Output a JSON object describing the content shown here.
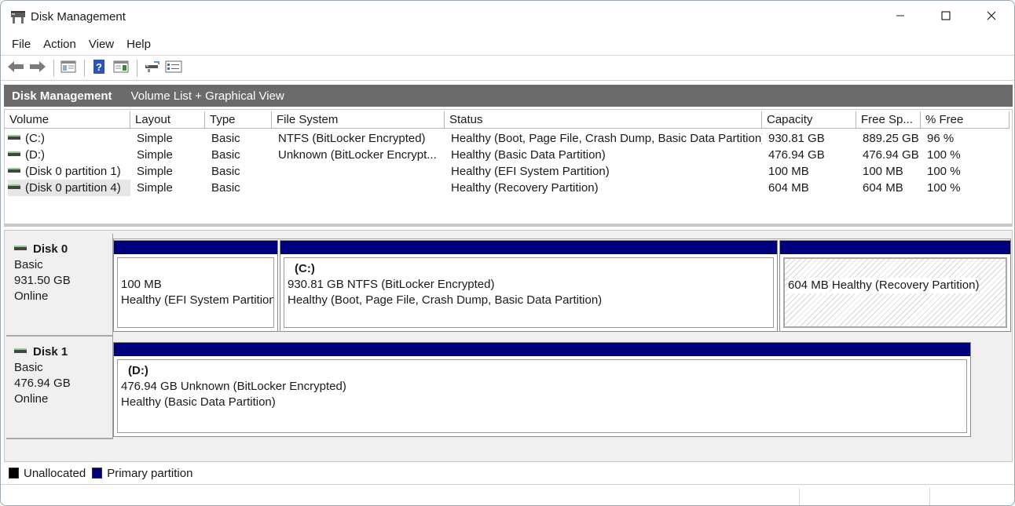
{
  "window": {
    "title": "Disk Management",
    "minimize_icon": "minimize-icon",
    "maximize_icon": "maximize-icon",
    "close_icon": "close-icon"
  },
  "menu": {
    "items": [
      "File",
      "Action",
      "View",
      "Help"
    ]
  },
  "toolbar": {
    "icons": [
      "back-arrow-icon",
      "forward-arrow-icon",
      "properties-panel-icon",
      "help-icon",
      "console-tree-icon",
      "rescan-disks-icon",
      "settings-list-icon"
    ]
  },
  "header": {
    "title": "Disk Management",
    "view": "Volume List + Graphical View"
  },
  "volume_list": {
    "columns": [
      "Volume",
      "Layout",
      "Type",
      "File System",
      "Status",
      "Capacity",
      "Free Sp...",
      "% Free"
    ],
    "rows": [
      {
        "volume": "(C:)",
        "layout": "Simple",
        "type": "Basic",
        "fs": "NTFS (BitLocker Encrypted)",
        "status": "Healthy (Boot, Page File, Crash Dump, Basic Data Partition)",
        "capacity": "930.81 GB",
        "free": "889.25 GB",
        "pct": "96 %"
      },
      {
        "volume": "(D:)",
        "layout": "Simple",
        "type": "Basic",
        "fs": "Unknown (BitLocker Encrypt...",
        "status": "Healthy (Basic Data Partition)",
        "capacity": "476.94 GB",
        "free": "476.94 GB",
        "pct": "100 %"
      },
      {
        "volume": "(Disk 0 partition 1)",
        "layout": "Simple",
        "type": "Basic",
        "fs": "",
        "status": "Healthy (EFI System Partition)",
        "capacity": "100 MB",
        "free": "100 MB",
        "pct": "100 %"
      },
      {
        "volume": "(Disk 0 partition 4)",
        "layout": "Simple",
        "type": "Basic",
        "fs": "",
        "status": "Healthy (Recovery Partition)",
        "capacity": "604 MB",
        "free": "604 MB",
        "pct": "100 %"
      }
    ]
  },
  "disks": [
    {
      "name": "Disk 0",
      "type": "Basic",
      "size": "931.50 GB",
      "state": "Online",
      "partitions": [
        {
          "name": "",
          "size": "100 MB",
          "status": "Healthy (EFI System Partition)"
        },
        {
          "name": "(C:)",
          "size": "930.81 GB NTFS (BitLocker Encrypted)",
          "status": "Healthy (Boot, Page File, Crash Dump, Basic Data Partition)"
        },
        {
          "name": "",
          "size": "604 MB",
          "status": "Healthy (Recovery Partition)"
        }
      ]
    },
    {
      "name": "Disk 1",
      "type": "Basic",
      "size": "476.94 GB",
      "state": "Online",
      "partitions": [
        {
          "name": "(D:)",
          "size": "476.94 GB Unknown (BitLocker Encrypted)",
          "status": "Healthy (Basic Data Partition)"
        }
      ]
    }
  ],
  "legend": {
    "items": [
      {
        "label": "Unallocated",
        "color": "#000000"
      },
      {
        "label": "Primary partition",
        "color": "#00007f"
      }
    ]
  },
  "colors": {
    "primary_partition_bar": "#00007f",
    "header_band": "#6b6b6b"
  }
}
